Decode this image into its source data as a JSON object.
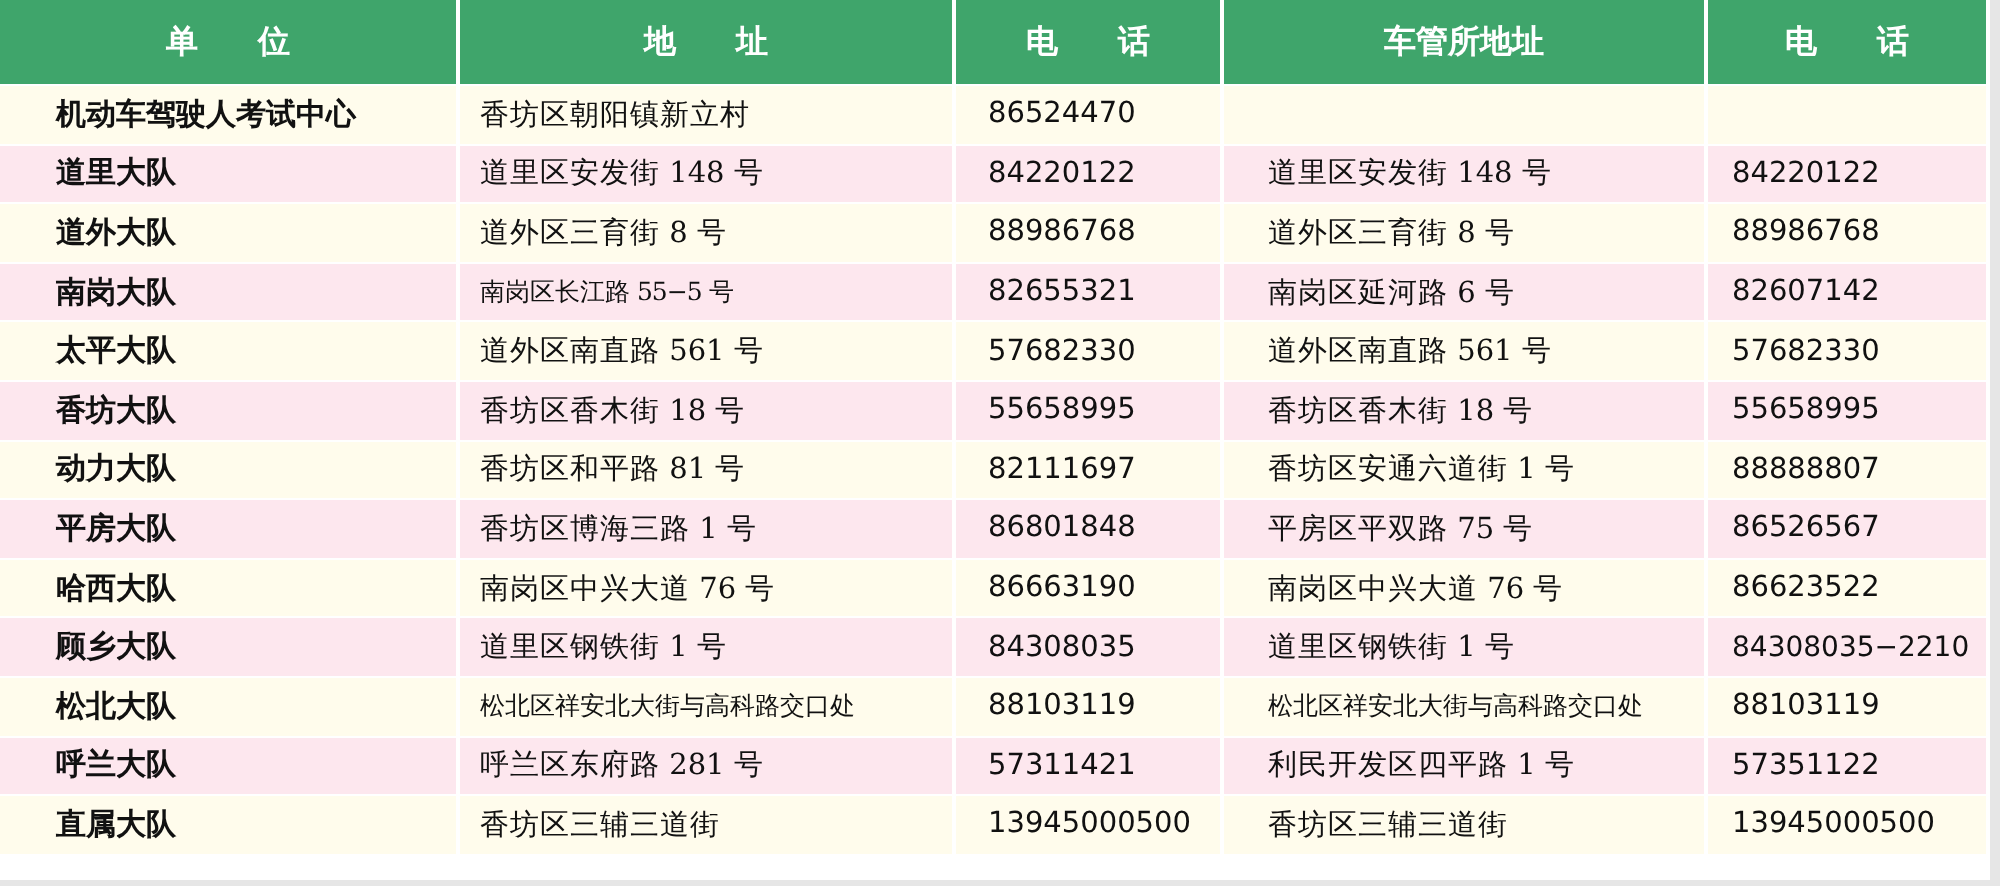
{
  "table": {
    "columns": [
      "单 位",
      "地 址",
      "电 话",
      "车管所地址",
      "电 话"
    ],
    "rows": [
      {
        "unit": "机动车驾驶人考试中心",
        "address": "香坊区朝阳镇新立村",
        "phone": "86524470"
      },
      {
        "unit": "道里大队",
        "address": "道里区安发街 148 号",
        "phone": "84220122",
        "office_address": "道里区安发街 148 号",
        "office_phone": "84220122"
      },
      {
        "unit": "道外大队",
        "address": "道外区三育街 8 号",
        "phone": "88986768",
        "office_address": "道外区三育街 8 号",
        "office_phone": "88986768"
      },
      {
        "unit": "南岗大队",
        "address": "南岗区长江路 55−5 号",
        "phone": "82655321",
        "office_address": "南岗区延河路 6 号",
        "office_phone": "82607142"
      },
      {
        "unit": "太平大队",
        "address": "道外区南直路 561 号",
        "phone": "57682330",
        "office_address": "道外区南直路 561 号",
        "office_phone": "57682330"
      },
      {
        "unit": "香坊大队",
        "address": "香坊区香木街 18 号",
        "phone": "55658995",
        "office_address": "香坊区香木街 18 号",
        "office_phone": "55658995"
      },
      {
        "unit": "动力大队",
        "address": "香坊区和平路 81 号",
        "phone": "82111697",
        "office_address": "香坊区安通六道街 1 号",
        "office_phone": "88888807"
      },
      {
        "unit": "平房大队",
        "address": "香坊区博海三路 1 号",
        "phone": "86801848",
        "office_address": "平房区平双路 75 号",
        "office_phone": "86526567"
      },
      {
        "unit": "哈西大队",
        "address": "南岗区中兴大道 76 号",
        "phone": "86663190",
        "office_address": "南岗区中兴大道 76 号",
        "office_phone": "86623522"
      },
      {
        "unit": "顾乡大队",
        "address": "道里区钢铁街 1 号",
        "phone": "84308035",
        "office_address": "道里区钢铁街 1 号",
        "office_phone": "84308035−2210"
      },
      {
        "unit": "松北大队",
        "address": "松北区祥安北大街与高科路交口处",
        "phone": "88103119",
        "office_address": "松北区祥安北大街与高科路交口处",
        "office_phone": "88103119"
      },
      {
        "unit": "呼兰大队",
        "address": "呼兰区东府路 281 号",
        "phone": "57311421",
        "office_address": "利民开发区四平路 1 号",
        "office_phone": "57351122"
      },
      {
        "unit": "直属大队",
        "address": "香坊区三辅三道街",
        "phone": "13945000500",
        "office_address": "香坊区三辅三道街",
        "office_phone": "13945000500"
      }
    ]
  }
}
